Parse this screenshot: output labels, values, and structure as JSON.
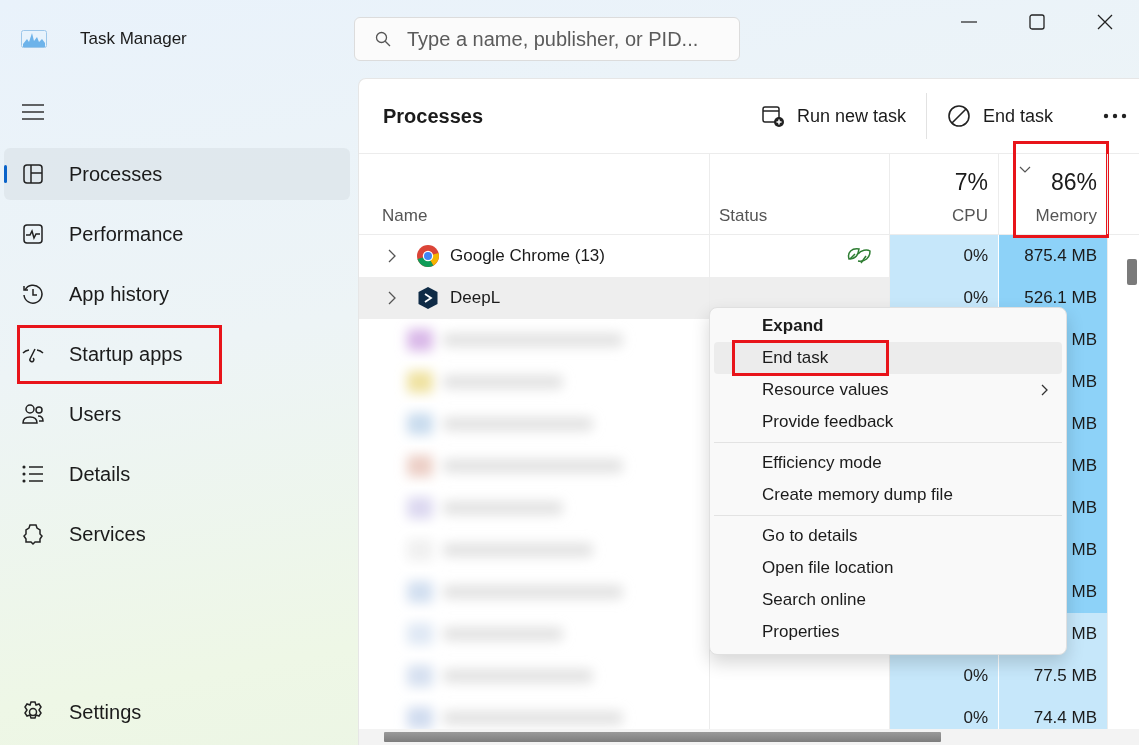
{
  "window": {
    "title": "Task Manager"
  },
  "search": {
    "placeholder": "Type a name, publisher, or PID..."
  },
  "sidebar": {
    "items": [
      {
        "label": "Processes",
        "selected": true,
        "highlighted": false
      },
      {
        "label": "Performance",
        "selected": false,
        "highlighted": false
      },
      {
        "label": "App history",
        "selected": false,
        "highlighted": false
      },
      {
        "label": "Startup apps",
        "selected": false,
        "highlighted": true
      },
      {
        "label": "Users",
        "selected": false,
        "highlighted": false
      },
      {
        "label": "Details",
        "selected": false,
        "highlighted": false
      },
      {
        "label": "Services",
        "selected": false,
        "highlighted": false
      }
    ],
    "settings": {
      "label": "Settings"
    }
  },
  "page": {
    "title": "Processes",
    "actions": [
      {
        "label": "Run new task"
      },
      {
        "label": "End task"
      }
    ]
  },
  "table": {
    "columns": [
      {
        "kind": "name",
        "label": "Name"
      },
      {
        "kind": "status",
        "label": "Status"
      },
      {
        "kind": "cpu",
        "label": "CPU",
        "total": "7%",
        "sorted": false,
        "highlighted": false
      },
      {
        "kind": "memory",
        "label": "Memory",
        "total": "86%",
        "sorted": true,
        "highlighted": true
      }
    ],
    "rows": [
      {
        "kind": "app",
        "name": "Google Chrome (13)",
        "efficiency": true,
        "hovered": false,
        "cpu": "0%",
        "memory": "875.4 MB",
        "high_memory": true
      },
      {
        "kind": "app",
        "name": "DeepL",
        "efficiency": false,
        "hovered": true,
        "cpu": "0%",
        "memory": "526.1 MB",
        "high_memory": true
      },
      {
        "kind": "blurred",
        "memory": "MB",
        "high_memory": true
      },
      {
        "kind": "blurred",
        "memory": "MB",
        "high_memory": true
      },
      {
        "kind": "blurred",
        "memory": "MB",
        "high_memory": true
      },
      {
        "kind": "blurred",
        "memory": "MB",
        "high_memory": true
      },
      {
        "kind": "blurred",
        "memory": "MB",
        "high_memory": true
      },
      {
        "kind": "blurred",
        "memory": "MB",
        "high_memory": true
      },
      {
        "kind": "blurred",
        "memory": "MB",
        "high_memory": true
      },
      {
        "kind": "blurred",
        "memory": "MB",
        "high_memory": false
      },
      {
        "kind": "blurred",
        "cpu": "0%",
        "memory": "77.5 MB",
        "high_memory": false
      },
      {
        "kind": "blurred",
        "cpu": "0%",
        "memory": "74.4 MB",
        "high_memory": false
      }
    ]
  },
  "context_menu": {
    "items": [
      {
        "kind": "item",
        "label": "Expand",
        "bold": true,
        "hovered": false,
        "submenu": false,
        "highlighted": false
      },
      {
        "kind": "item",
        "label": "End task",
        "bold": false,
        "hovered": true,
        "submenu": false,
        "highlighted": true
      },
      {
        "kind": "item",
        "label": "Resource values",
        "bold": false,
        "hovered": false,
        "submenu": true,
        "highlighted": false
      },
      {
        "kind": "item",
        "label": "Provide feedback",
        "bold": false,
        "hovered": false,
        "submenu": false,
        "highlighted": false
      },
      {
        "kind": "separator"
      },
      {
        "kind": "item",
        "label": "Efficiency mode",
        "bold": false,
        "hovered": false,
        "submenu": false,
        "highlighted": false
      },
      {
        "kind": "item",
        "label": "Create memory dump file",
        "bold": false,
        "hovered": false,
        "submenu": false,
        "highlighted": false
      },
      {
        "kind": "separator"
      },
      {
        "kind": "item",
        "label": "Go to details",
        "bold": false,
        "hovered": false,
        "submenu": false,
        "highlighted": false
      },
      {
        "kind": "item",
        "label": "Open file location",
        "bold": false,
        "hovered": false,
        "submenu": false,
        "highlighted": false
      },
      {
        "kind": "item",
        "label": "Search online",
        "bold": false,
        "hovered": false,
        "submenu": false,
        "highlighted": false
      },
      {
        "kind": "item",
        "label": "Properties",
        "bold": false,
        "hovered": false,
        "submenu": false,
        "highlighted": false
      }
    ]
  }
}
